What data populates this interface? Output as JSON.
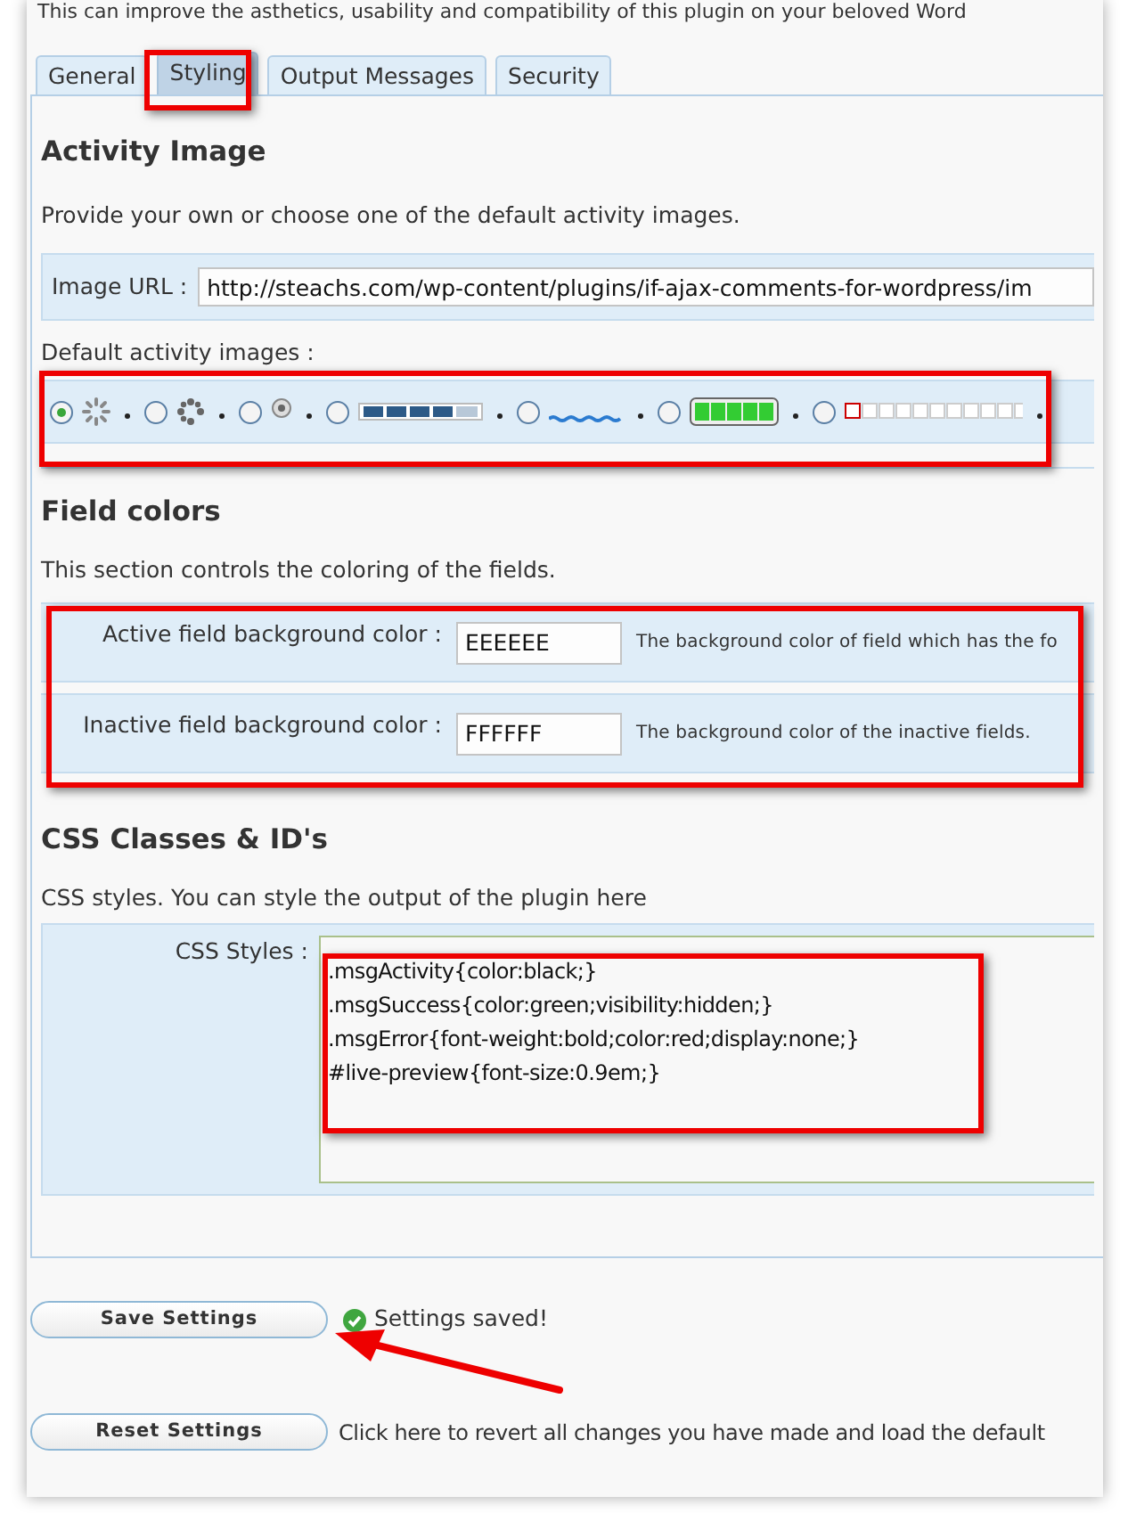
{
  "intro": "This can improve the asthetics, usability and compatibility of this plugin on your beloved Word",
  "tabs": [
    {
      "label": "General",
      "selected": false
    },
    {
      "label": "Styling",
      "selected": true
    },
    {
      "label": "Output Messages",
      "selected": false
    },
    {
      "label": "Security",
      "selected": false
    }
  ],
  "activity_image": {
    "heading": "Activity Image",
    "description": "Provide your own or choose one of the default activity images.",
    "image_url": {
      "label": "Image URL :",
      "value": "http://steachs.com/wp-content/plugins/if-ajax-comments-for-wordpress/im"
    },
    "options_label": "Default activity images :",
    "options": [
      {
        "kind": "spinner",
        "selected": true
      },
      {
        "kind": "dots",
        "selected": false
      },
      {
        "kind": "circle",
        "selected": false
      },
      {
        "kind": "blocks",
        "selected": false
      },
      {
        "kind": "wave",
        "selected": false
      },
      {
        "kind": "battery",
        "selected": false
      },
      {
        "kind": "squares",
        "selected": false
      }
    ]
  },
  "field_colors": {
    "heading": "Field colors",
    "description": "This section controls the coloring of the fields.",
    "fields": [
      {
        "label": "Active field background color :",
        "value": "EEEEEE",
        "hint": "The background color of field which has the fo"
      },
      {
        "label": "Inactive field background color :",
        "value": "FFFFFF",
        "hint": "The background color of the inactive fields."
      }
    ]
  },
  "css_classes": {
    "heading": "CSS Classes & ID's",
    "description": "CSS styles. You can style the output of the plugin here",
    "label": "CSS Styles :",
    "value": ".msgActivity{color:black;}\n.msgSuccess{color:green;visibility:hidden;}\n.msgError{font-weight:bold;color:red;display:none;}\n#live-preview{font-size:0.9em;}"
  },
  "save": {
    "button": "Save Settings",
    "message": "Settings saved!"
  },
  "reset": {
    "button": "Reset Settings",
    "text": "Click here to revert all changes you have made and load the default"
  }
}
